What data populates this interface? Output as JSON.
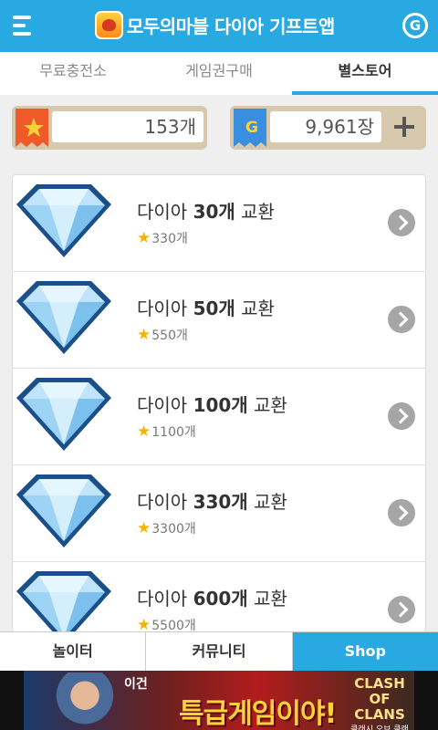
{
  "header": {
    "title": "모두의마블 다이아 기프트앱",
    "g_label": "G"
  },
  "tabs": [
    {
      "label": "무료충전소",
      "active": false
    },
    {
      "label": "게임권구매",
      "active": false
    },
    {
      "label": "별스토어",
      "active": true
    }
  ],
  "wallet": {
    "stars": "153개",
    "gems": "9,961장",
    "gem_badge": "G"
  },
  "items": [
    {
      "name": "다이아",
      "amount": "30개",
      "suffix": "교환",
      "price": "330개"
    },
    {
      "name": "다이아",
      "amount": "50개",
      "suffix": "교환",
      "price": "550개"
    },
    {
      "name": "다이아",
      "amount": "100개",
      "suffix": "교환",
      "price": "1100개"
    },
    {
      "name": "다이아",
      "amount": "330개",
      "suffix": "교환",
      "price": "3300개"
    },
    {
      "name": "다이아",
      "amount": "600개",
      "suffix": "교환",
      "price": "5500개"
    }
  ],
  "bottom_nav": [
    {
      "label": "놀이터",
      "active": false
    },
    {
      "label": "커뮤니티",
      "active": false
    },
    {
      "label": "Shop",
      "active": true
    }
  ],
  "ad": {
    "small_text": "이건",
    "main_text": "특급게임이야!",
    "logo_text": "CLASH OF CLANS",
    "logo_sub": "클래시 오브 클랜"
  },
  "colors": {
    "primary": "#29a9e1",
    "wallet_bg": "#d6c9ae",
    "star": "#f4b400"
  }
}
